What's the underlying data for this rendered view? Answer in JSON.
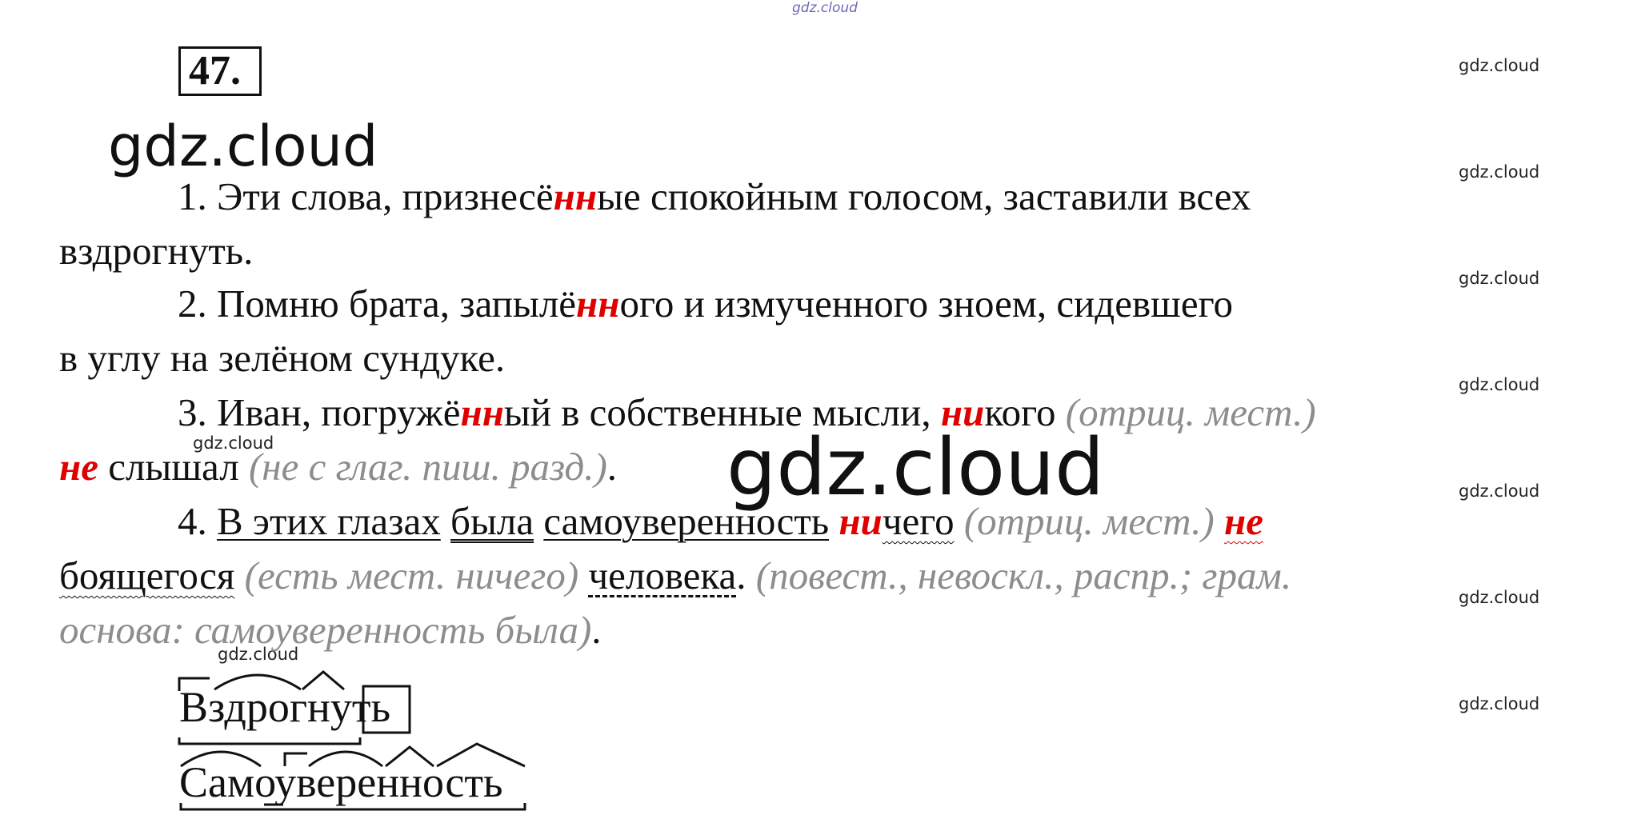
{
  "watermark": "gdz.cloud",
  "exercise_number": "47.",
  "sentences": {
    "s1": {
      "line1_a": "1. Эти слова, признесё",
      "line1_red": "нн",
      "line1_b": "ые спокойным голосом, заставили всех",
      "line2": "вздрогнуть."
    },
    "s2": {
      "line1_a": "2. Помню брата, запылё",
      "line1_red": "нн",
      "line1_b": "ого и измученного зноем, сидевшего",
      "line2": "в углу на зелёном сундуке."
    },
    "s3": {
      "line1_a": "3. Иван, погружё",
      "line1_red": "нн",
      "line1_b": "ый в собственные мысли, ",
      "line1_red2": "ни",
      "line1_c": "кого ",
      "line1_gray": "(отриц. мест.)",
      "line2_red": "не",
      "line2_a": " слышал ",
      "line2_gray": "(не с глаг. пиш. разд.)",
      "line2_end": "."
    },
    "s4": {
      "line1_a": "4. ",
      "line1_u1": "В этих глазах",
      "line1_sp": " ",
      "line1_u2a": "была",
      "line1_sp2": " ",
      "line1_u1b": "самоуверенность",
      "line1_sp3": " ",
      "line1_red": "ни",
      "line1_wave": "чего",
      "line1_sp4": " ",
      "line1_gray": "(отриц. мест.)",
      "line1_sp5": " ",
      "line1_red2": "не",
      "line2_wave": "боящегося",
      "line2_sp": " ",
      "line2_gray": "(есть мест. ничего)",
      "line2_sp2": " ",
      "line2_dash": "человека",
      "line2_dot": ". ",
      "line2_gray2": "(повест., невоскл., распр.; грам.",
      "line3_gray": "основа: самоуверенность была)",
      "line3_dot": "."
    }
  },
  "morphemes": {
    "word1": "Вздрогнуть",
    "word2": "Самоуверенность"
  }
}
